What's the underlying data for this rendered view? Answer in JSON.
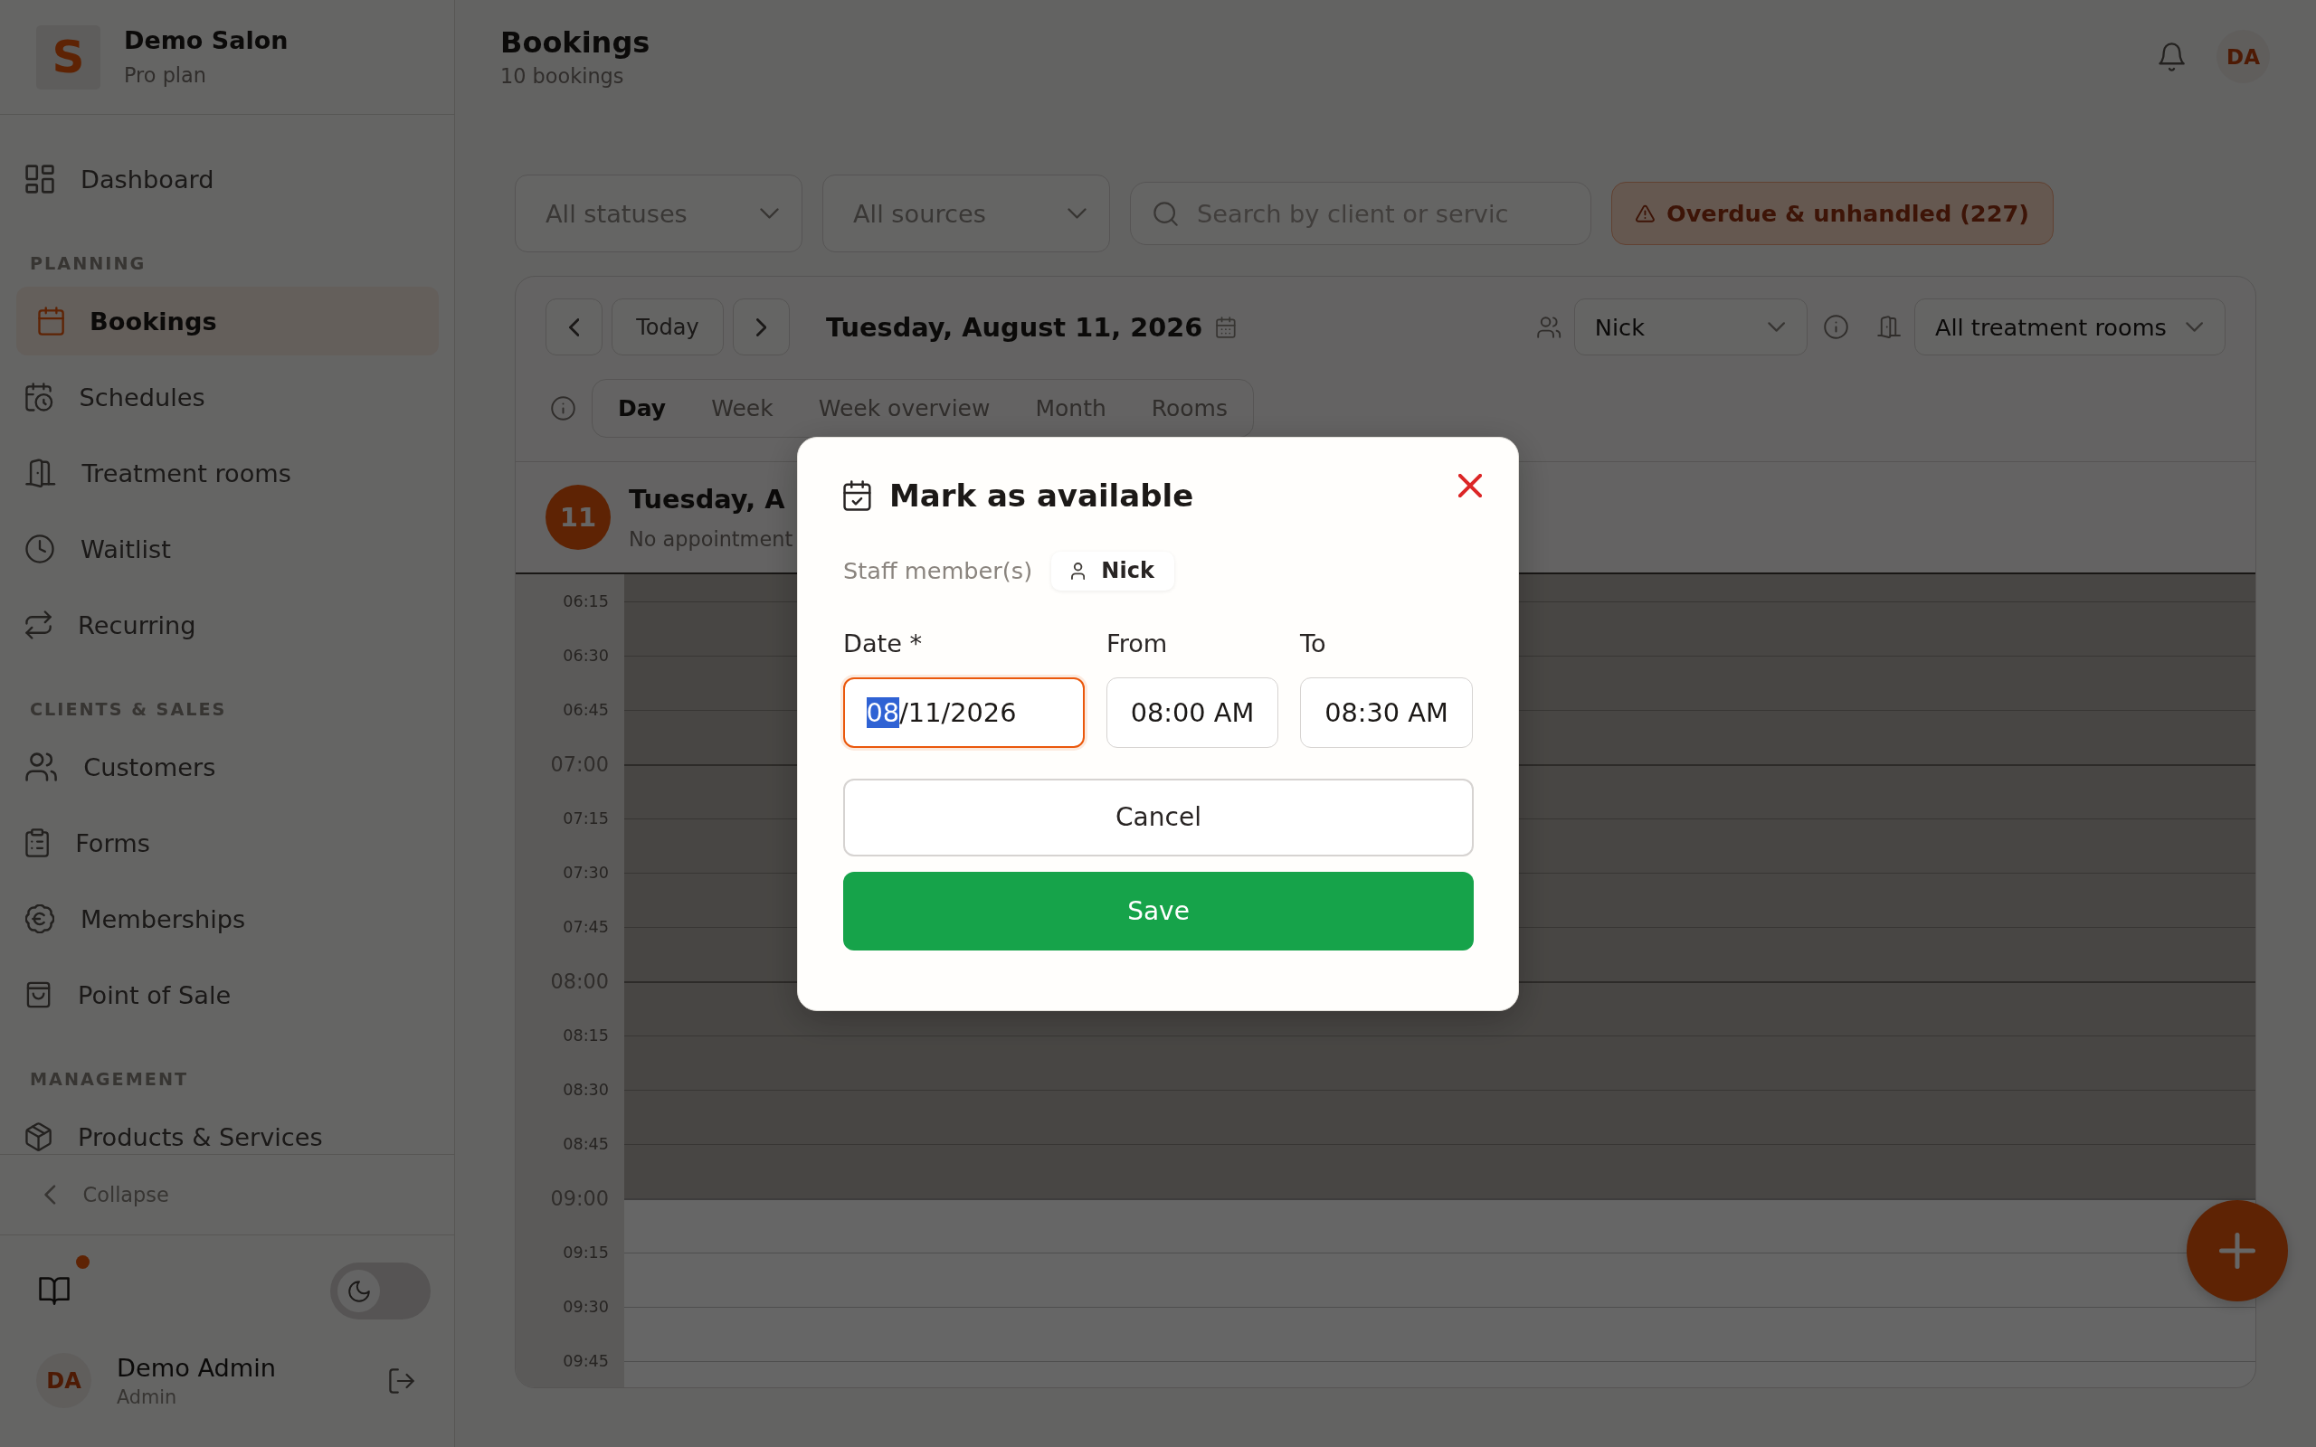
{
  "sidebar": {
    "brand": {
      "logo_letter": "S",
      "name": "Demo Salon",
      "plan": "Pro plan"
    },
    "sections": [
      {
        "items": [
          {
            "label": "Dashboard",
            "selected": false
          }
        ]
      },
      {
        "heading": "PLANNING",
        "items": [
          {
            "label": "Bookings",
            "selected": true
          },
          {
            "label": "Schedules",
            "selected": false
          },
          {
            "label": "Treatment rooms",
            "selected": false
          },
          {
            "label": "Waitlist",
            "selected": false
          },
          {
            "label": "Recurring",
            "selected": false
          }
        ]
      },
      {
        "heading": "CLIENTS & SALES",
        "items": [
          {
            "label": "Customers",
            "selected": false
          },
          {
            "label": "Forms",
            "selected": false
          },
          {
            "label": "Memberships",
            "selected": false
          },
          {
            "label": "Point of Sale",
            "selected": false
          }
        ]
      },
      {
        "heading": "MANAGEMENT",
        "items": [
          {
            "label": "Products & Services",
            "selected": false
          }
        ]
      }
    ],
    "collapse": {
      "label": "Collapse"
    },
    "guide": {
      "notification": true
    },
    "dark_mode": {
      "on": false
    },
    "user": {
      "initials": "DA",
      "name": "Demo Admin",
      "role": "Admin"
    }
  },
  "header": {
    "title": "Bookings",
    "subtitle": "10 bookings",
    "user_initials": "DA"
  },
  "filters": {
    "status": "All statuses",
    "source": "All sources",
    "search": {
      "placeholder": "Search by client or servic"
    },
    "overdue": "Overdue & unhandled (227)"
  },
  "calendar": {
    "today": "Today",
    "date": "Tuesday, August 11, 2026",
    "staff": "Nick",
    "rooms": "All treatment rooms",
    "views": [
      {
        "label": "Day",
        "selected": true
      },
      {
        "label": "Week",
        "selected": false
      },
      {
        "label": "Week overview",
        "selected": false
      },
      {
        "label": "Month",
        "selected": false
      },
      {
        "label": "Rooms",
        "selected": false
      }
    ],
    "day": {
      "number": "11",
      "title": "Tuesday, A",
      "subtitle": "No appointment"
    },
    "slots": [
      {
        "time": "06:15",
        "kind": "quarter",
        "available": false
      },
      {
        "time": "06:30",
        "kind": "quarter",
        "available": false
      },
      {
        "time": "06:45",
        "kind": "quarter",
        "available": false
      },
      {
        "time": "07:00",
        "kind": "hour",
        "available": false
      },
      {
        "time": "07:15",
        "kind": "quarter",
        "available": false
      },
      {
        "time": "07:30",
        "kind": "quarter",
        "available": false
      },
      {
        "time": "07:45",
        "kind": "quarter",
        "available": false
      },
      {
        "time": "08:00",
        "kind": "hour",
        "available": false
      },
      {
        "time": "08:15",
        "kind": "quarter",
        "available": false
      },
      {
        "time": "08:30",
        "kind": "quarter",
        "available": false
      },
      {
        "time": "08:45",
        "kind": "quarter",
        "available": false
      },
      {
        "time": "09:00",
        "kind": "hour",
        "available": true
      },
      {
        "time": "09:15",
        "kind": "quarter",
        "available": true
      },
      {
        "time": "09:30",
        "kind": "quarter",
        "available": true
      },
      {
        "time": "09:45",
        "kind": "quarter",
        "available": true
      }
    ]
  },
  "modal": {
    "title": "Mark as available",
    "staff_label": "Staff member(s)",
    "staff": [
      "Nick"
    ],
    "date": {
      "label": "Date *",
      "focused": true,
      "segments": [
        {
          "text": "08",
          "selected": true
        },
        {
          "text": "/11/2026",
          "selected": false
        }
      ]
    },
    "from": {
      "label": "From",
      "value": "08:00 AM"
    },
    "to": {
      "label": "To",
      "value": "08:30 AM"
    },
    "buttons": [
      {
        "label": "Cancel",
        "kind": "secondary"
      },
      {
        "label": "Save",
        "kind": "primary"
      }
    ]
  }
}
